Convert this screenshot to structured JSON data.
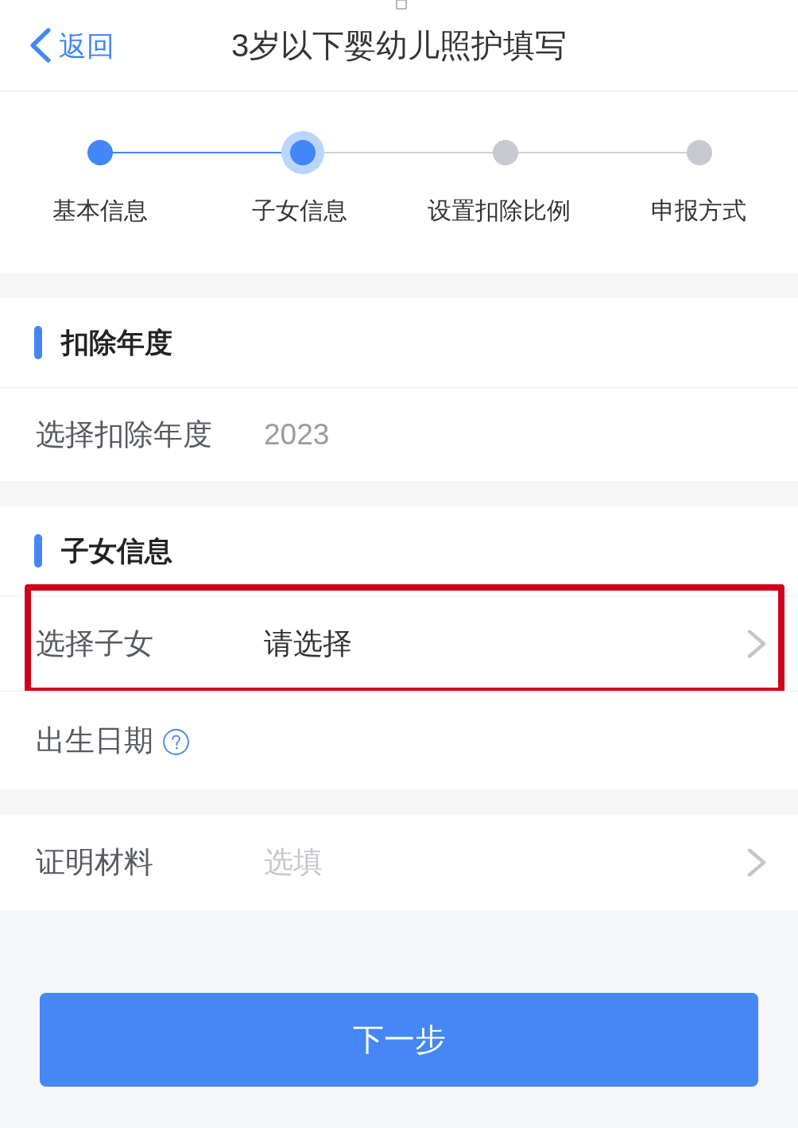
{
  "header": {
    "back_label": "返回",
    "title": "3岁以下婴幼儿照护填写"
  },
  "steps": [
    {
      "label": "基本信息",
      "completed": true,
      "selected": false
    },
    {
      "label": "子女信息",
      "completed": false,
      "selected": true
    },
    {
      "label": "设置扣除比例",
      "completed": false,
      "selected": false
    },
    {
      "label": "申报方式",
      "completed": false,
      "selected": false
    }
  ],
  "sections": [
    {
      "title": "扣除年度",
      "rows": [
        {
          "kind": "value",
          "label": "选择扣除年度",
          "value": "2023"
        }
      ]
    },
    {
      "title": "子女信息",
      "rows": [
        {
          "kind": "select",
          "label": "选择子女",
          "value": "请选择",
          "highlighted": true
        },
        {
          "kind": "help",
          "label": "出生日期"
        }
      ]
    },
    {
      "rows": [
        {
          "kind": "select",
          "label": "证明材料",
          "placeholder": "选填",
          "highlighted": false
        }
      ]
    }
  ],
  "next_button": "下一步"
}
